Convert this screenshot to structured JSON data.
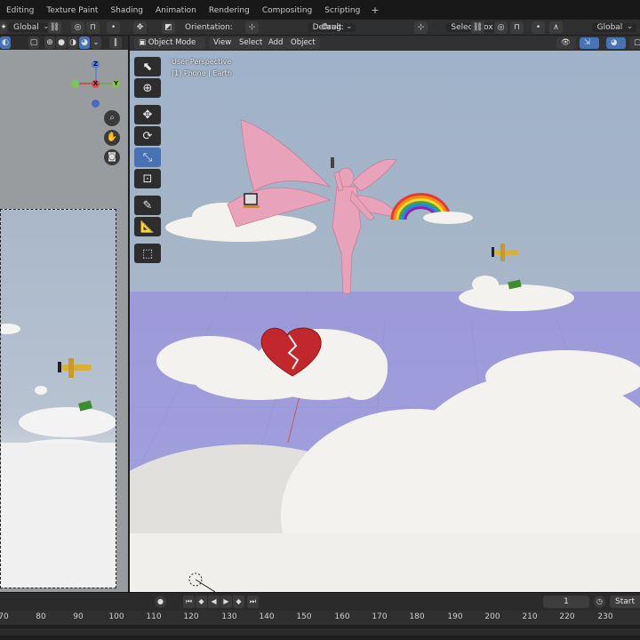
{
  "workspace_tabs": [
    "Editing",
    "Texture Paint",
    "Shading",
    "Animation",
    "Rendering",
    "Compositing",
    "Scripting",
    "+"
  ],
  "header": {
    "left_transform": "Global",
    "orientation_label": "Orientation:",
    "orientation_value": "Default",
    "drag_label": "Drag:",
    "drag_value": "Select Box",
    "right_transform": "Global"
  },
  "viewport": {
    "mode": "Object Mode",
    "menus": [
      "View",
      "Select",
      "Add",
      "Object"
    ],
    "perspective": "User Perspective",
    "collection": "(1) Phone | Earth"
  },
  "gizmo": {
    "x": "X",
    "y": "Y",
    "z": "Z"
  },
  "timeline": {
    "current_frame": "1",
    "start_label": "Start",
    "ruler_ticks": [
      "70",
      "80",
      "90",
      "100",
      "110",
      "120",
      "130",
      "140",
      "150",
      "160",
      "170",
      "180",
      "190",
      "200",
      "210",
      "220",
      "230"
    ]
  },
  "icons": {
    "tool_select": "select-box-icon",
    "tool_cursor": "cursor-icon",
    "tool_move": "move-icon",
    "tool_rotate": "rotate-icon",
    "tool_scale": "scale-icon",
    "tool_transform": "transform-icon",
    "tool_annotate": "annotate-icon",
    "tool_measure": "measure-icon",
    "tool_add_cube": "add-cube-icon"
  },
  "colors": {
    "accent": "#4772b3",
    "ground": "#9d9ad8",
    "sky": "#a7b6c8",
    "angel": "#e8a2ba",
    "heart": "#c0282e"
  }
}
